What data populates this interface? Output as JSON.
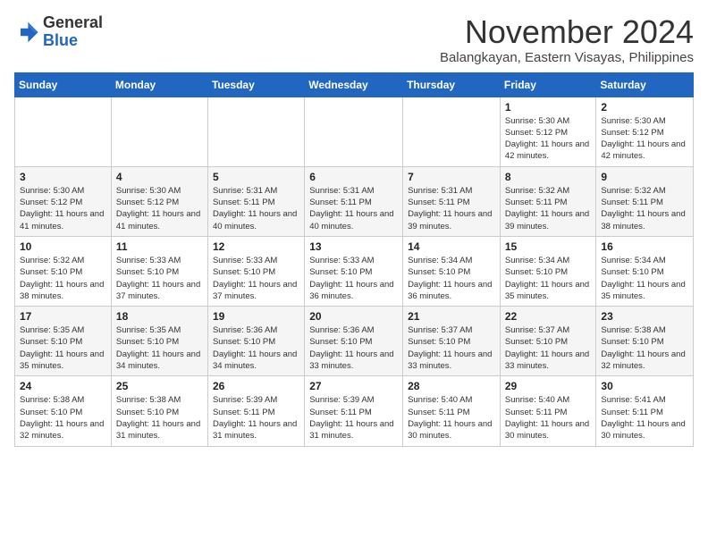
{
  "header": {
    "logo_general": "General",
    "logo_blue": "Blue",
    "month_title": "November 2024",
    "location": "Balangkayan, Eastern Visayas, Philippines"
  },
  "calendar": {
    "days_of_week": [
      "Sunday",
      "Monday",
      "Tuesday",
      "Wednesday",
      "Thursday",
      "Friday",
      "Saturday"
    ],
    "weeks": [
      [
        {
          "day": "",
          "info": ""
        },
        {
          "day": "",
          "info": ""
        },
        {
          "day": "",
          "info": ""
        },
        {
          "day": "",
          "info": ""
        },
        {
          "day": "",
          "info": ""
        },
        {
          "day": "1",
          "info": "Sunrise: 5:30 AM\nSunset: 5:12 PM\nDaylight: 11 hours and 42 minutes."
        },
        {
          "day": "2",
          "info": "Sunrise: 5:30 AM\nSunset: 5:12 PM\nDaylight: 11 hours and 42 minutes."
        }
      ],
      [
        {
          "day": "3",
          "info": "Sunrise: 5:30 AM\nSunset: 5:12 PM\nDaylight: 11 hours and 41 minutes."
        },
        {
          "day": "4",
          "info": "Sunrise: 5:30 AM\nSunset: 5:12 PM\nDaylight: 11 hours and 41 minutes."
        },
        {
          "day": "5",
          "info": "Sunrise: 5:31 AM\nSunset: 5:11 PM\nDaylight: 11 hours and 40 minutes."
        },
        {
          "day": "6",
          "info": "Sunrise: 5:31 AM\nSunset: 5:11 PM\nDaylight: 11 hours and 40 minutes."
        },
        {
          "day": "7",
          "info": "Sunrise: 5:31 AM\nSunset: 5:11 PM\nDaylight: 11 hours and 39 minutes."
        },
        {
          "day": "8",
          "info": "Sunrise: 5:32 AM\nSunset: 5:11 PM\nDaylight: 11 hours and 39 minutes."
        },
        {
          "day": "9",
          "info": "Sunrise: 5:32 AM\nSunset: 5:11 PM\nDaylight: 11 hours and 38 minutes."
        }
      ],
      [
        {
          "day": "10",
          "info": "Sunrise: 5:32 AM\nSunset: 5:10 PM\nDaylight: 11 hours and 38 minutes."
        },
        {
          "day": "11",
          "info": "Sunrise: 5:33 AM\nSunset: 5:10 PM\nDaylight: 11 hours and 37 minutes."
        },
        {
          "day": "12",
          "info": "Sunrise: 5:33 AM\nSunset: 5:10 PM\nDaylight: 11 hours and 37 minutes."
        },
        {
          "day": "13",
          "info": "Sunrise: 5:33 AM\nSunset: 5:10 PM\nDaylight: 11 hours and 36 minutes."
        },
        {
          "day": "14",
          "info": "Sunrise: 5:34 AM\nSunset: 5:10 PM\nDaylight: 11 hours and 36 minutes."
        },
        {
          "day": "15",
          "info": "Sunrise: 5:34 AM\nSunset: 5:10 PM\nDaylight: 11 hours and 35 minutes."
        },
        {
          "day": "16",
          "info": "Sunrise: 5:34 AM\nSunset: 5:10 PM\nDaylight: 11 hours and 35 minutes."
        }
      ],
      [
        {
          "day": "17",
          "info": "Sunrise: 5:35 AM\nSunset: 5:10 PM\nDaylight: 11 hours and 35 minutes."
        },
        {
          "day": "18",
          "info": "Sunrise: 5:35 AM\nSunset: 5:10 PM\nDaylight: 11 hours and 34 minutes."
        },
        {
          "day": "19",
          "info": "Sunrise: 5:36 AM\nSunset: 5:10 PM\nDaylight: 11 hours and 34 minutes."
        },
        {
          "day": "20",
          "info": "Sunrise: 5:36 AM\nSunset: 5:10 PM\nDaylight: 11 hours and 33 minutes."
        },
        {
          "day": "21",
          "info": "Sunrise: 5:37 AM\nSunset: 5:10 PM\nDaylight: 11 hours and 33 minutes."
        },
        {
          "day": "22",
          "info": "Sunrise: 5:37 AM\nSunset: 5:10 PM\nDaylight: 11 hours and 33 minutes."
        },
        {
          "day": "23",
          "info": "Sunrise: 5:38 AM\nSunset: 5:10 PM\nDaylight: 11 hours and 32 minutes."
        }
      ],
      [
        {
          "day": "24",
          "info": "Sunrise: 5:38 AM\nSunset: 5:10 PM\nDaylight: 11 hours and 32 minutes."
        },
        {
          "day": "25",
          "info": "Sunrise: 5:38 AM\nSunset: 5:10 PM\nDaylight: 11 hours and 31 minutes."
        },
        {
          "day": "26",
          "info": "Sunrise: 5:39 AM\nSunset: 5:11 PM\nDaylight: 11 hours and 31 minutes."
        },
        {
          "day": "27",
          "info": "Sunrise: 5:39 AM\nSunset: 5:11 PM\nDaylight: 11 hours and 31 minutes."
        },
        {
          "day": "28",
          "info": "Sunrise: 5:40 AM\nSunset: 5:11 PM\nDaylight: 11 hours and 30 minutes."
        },
        {
          "day": "29",
          "info": "Sunrise: 5:40 AM\nSunset: 5:11 PM\nDaylight: 11 hours and 30 minutes."
        },
        {
          "day": "30",
          "info": "Sunrise: 5:41 AM\nSunset: 5:11 PM\nDaylight: 11 hours and 30 minutes."
        }
      ]
    ]
  }
}
